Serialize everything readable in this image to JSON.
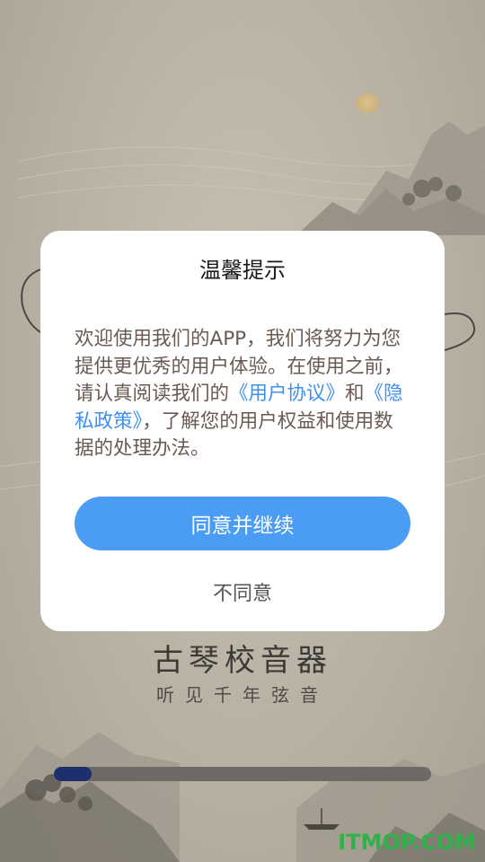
{
  "background": {
    "app_title": "古琴校音器",
    "app_subtitle": "听见千年弦音",
    "loading_progress": 0.1,
    "watermark": "ITMOP.COM"
  },
  "dialog": {
    "title": "温馨提示",
    "body_part1": "欢迎使用我们的APP，我们将努力为您提供更优秀的用户体验。在使用之前，请认真阅读我们的",
    "user_agreement_link": "《用户协议》",
    "body_part2": "和",
    "privacy_policy_link": "《隐私政策》",
    "body_part3": "，了解您的用户权益和使用数据的处理办法。",
    "agree_button": "同意并继续",
    "disagree_button": "不同意"
  },
  "colors": {
    "accent": "#4a9cf4",
    "link": "#3f8ff0",
    "progress_fill": "#1e2f6e",
    "watermark": "#2fb24a"
  }
}
